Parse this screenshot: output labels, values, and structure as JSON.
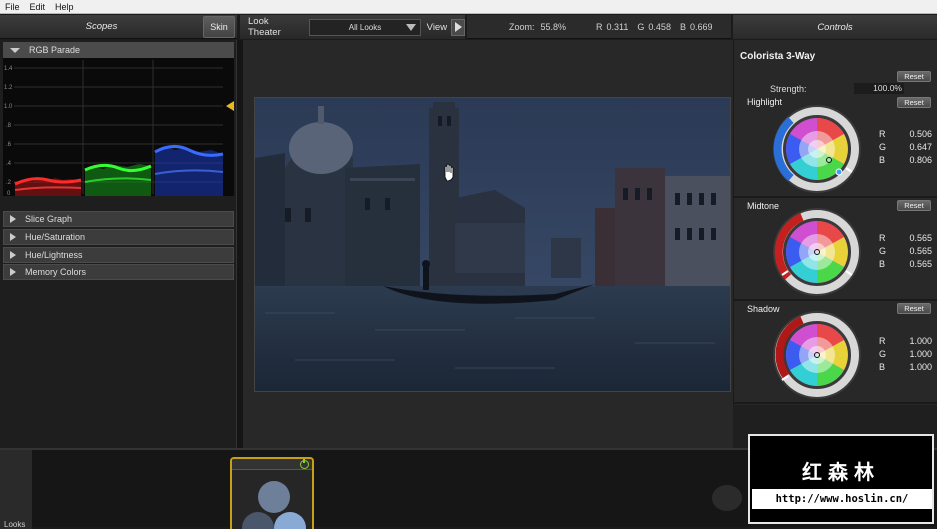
{
  "menu": [
    "File",
    "Edit",
    "Help"
  ],
  "scopes": {
    "title": "Scopes",
    "skin_label": "Skin",
    "sections": [
      {
        "label": "RGB Parade",
        "open": true
      },
      {
        "label": "Slice Graph",
        "open": false
      },
      {
        "label": "Hue/Saturation",
        "open": false
      },
      {
        "label": "Hue/Lightness",
        "open": false
      },
      {
        "label": "Memory Colors",
        "open": false
      }
    ],
    "parade_ticks": [
      "1.4",
      "1.2",
      "1.0",
      ".8",
      ".6",
      ".4",
      ".2",
      "0"
    ]
  },
  "theater": {
    "label": "Look Theater",
    "selected_look": "All Looks",
    "view_label": "View"
  },
  "info": {
    "zoom_label": "Zoom:",
    "zoom_value": "55.8%",
    "r_label": "R",
    "r_value": "0.311",
    "g_label": "G",
    "g_value": "0.458",
    "b_label": "B",
    "b_value": "0.669"
  },
  "controls": {
    "title": "Controls",
    "effect_name": "Colorista 3-Way",
    "reset_label": "Reset",
    "strength_label": "Strength:",
    "strength_value": "100.0%",
    "wheels": [
      {
        "name": "Highlight",
        "r": "0.506",
        "g": "0.647",
        "b": "0.806"
      },
      {
        "name": "Midtone",
        "r": "0.565",
        "g": "0.565",
        "b": "0.565"
      },
      {
        "name": "Shadow",
        "r": "1.000",
        "g": "1.000",
        "b": "1.000"
      }
    ]
  },
  "bottom": {
    "looks_tab": "Looks"
  },
  "watermark": {
    "chinese": "红森林",
    "url": "http://www.hoslin.cn/"
  }
}
